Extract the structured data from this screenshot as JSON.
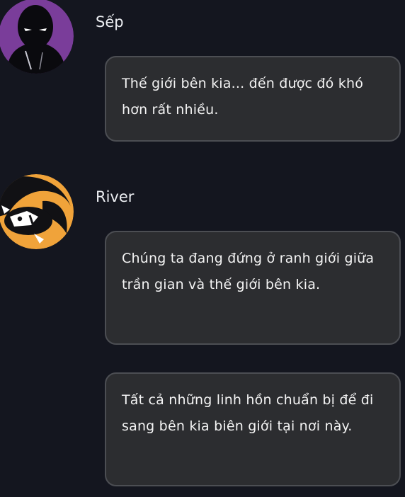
{
  "messages": [
    {
      "sender": "Sếp",
      "avatar_icon": "shadow-figure-avatar-icon",
      "bubbles": [
        "Thế giới bên kia... đến được đó khó hơn rất nhiều."
      ]
    },
    {
      "sender": "River",
      "avatar_icon": "masked-character-avatar-icon",
      "bubbles": [
        "Chúng ta đang đứng ở ranh giới giữa trần gian và thế giới bên kia.",
        "Tất cả những linh hồn chuẩn bị để đi sang bên kia biên giới tại nơi này."
      ]
    }
  ],
  "colors": {
    "background": "#14161f",
    "bubble_fill": "#2c2d30",
    "bubble_border": "#4c4e53",
    "avatar_sep_bg": "#7a3d9a",
    "avatar_river_bg": "#f0a33a"
  }
}
